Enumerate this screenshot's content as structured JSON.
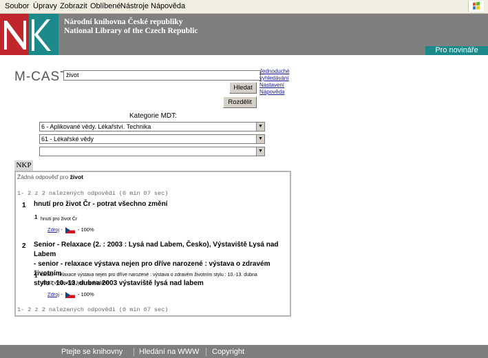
{
  "menubar": {
    "items": [
      "Soubor",
      "Úpravy",
      "Zobrazit",
      "Oblíbené",
      "Nástroje",
      "Nápověda"
    ]
  },
  "header": {
    "library_name_cz": "Národní knihovna České republiky",
    "library_name_en": "National Library of the Czech Republic",
    "press_tab": "Pro novináře"
  },
  "search": {
    "title": "M-CAST",
    "query": "život",
    "search_button": "Hledat",
    "split_button": "Rozdělit",
    "links": [
      "Jednoduché vyhledávání",
      "Nastavení",
      "Nápověda"
    ]
  },
  "categories": {
    "label": "Kategorie MDT:",
    "selects": [
      "6 - Aplikované vědy. Lékařství. Technika",
      "61 - Lékařské vědy",
      ""
    ]
  },
  "results": {
    "tab": "NKP",
    "no_result_prefix": "Žádná odpověď pro",
    "no_result_term": "život",
    "count_top": "1- 2 z 2 nalezených odpovědí (0 min 07 sec)",
    "count_bottom": "1- 2 z 2 nalezených odpovědí (0 min 07 sec)",
    "items": [
      {
        "num": "1",
        "title": "hnutí pro život Čr - potrat všechno změní",
        "sub_num": "1",
        "sub_text": "hnutí pro život Čr",
        "source_label": "Zdroj",
        "score": "100%"
      },
      {
        "num": "2",
        "title_line1": "Senior - Relaxace (2. : 2003 : Lysá nad Labem, Česko), Výstaviště Lysá nad Labem",
        "title_line2": "- senior - relaxace výstava nejen pro dříve narozené : výstava o zdravém životním",
        "title_line3": "stylu : 10.-13. dubna 2003 výstaviště lysá nad labem",
        "sub_num": "1",
        "sub_line1": "senior - relaxace výstava nejen pro dříve narozené : výstava o zdravém životním stylu : 10.-13. dubna",
        "sub_line2": "2003 výstaviště lysá nad labem",
        "source_label": "Zdroj",
        "score": "100%"
      }
    ]
  },
  "footer": {
    "items": [
      "Ptejte se knihovny",
      "Hledání na WWW",
      "Copyright"
    ]
  },
  "colors": {
    "header_gray": "#7f7f7f",
    "logo_red": "#c0272d",
    "logo_teal": "#1c8a8a",
    "link_blue": "#1a1a99"
  },
  "icons": [
    "nk-logo-icon",
    "windows-logo-icon",
    "czech-flag-icon",
    "dropdown-arrow-icon"
  ]
}
